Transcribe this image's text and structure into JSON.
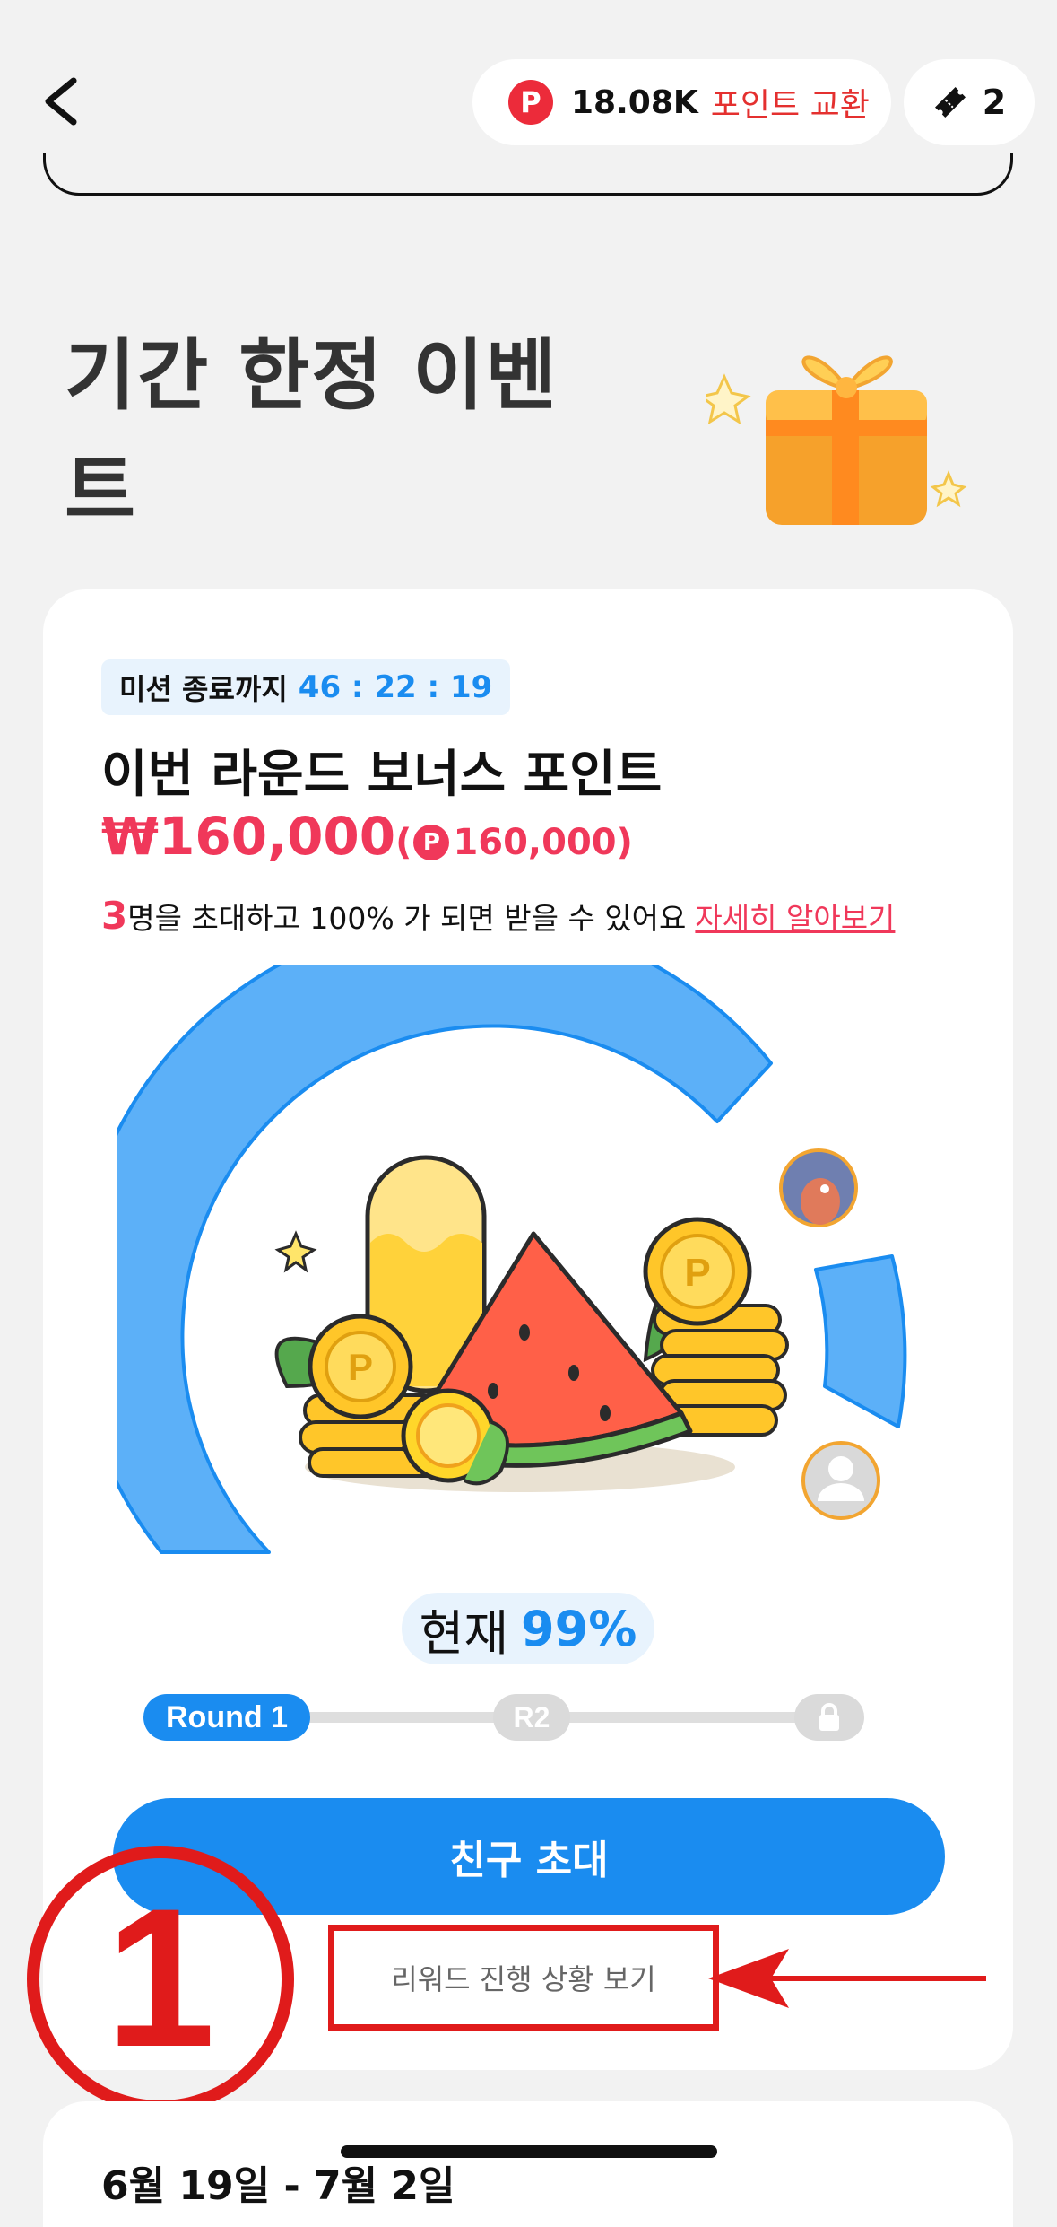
{
  "top_bar": {
    "back_icon": "chevron-left-icon",
    "points_icon": "P",
    "points_value": "18.08K",
    "points_exchange_label": "포인트 교환",
    "ticket_icon": "ticket-icon",
    "ticket_count": "2"
  },
  "event": {
    "title_line1": "기간 한정 이벤",
    "title_line2": "트",
    "gift_icon": "gift-box-icon"
  },
  "mission": {
    "timer_label": "미션 종료까지",
    "timer_value": "46 : 22 : 19",
    "round_title": "이번 라운드 보너스 포인트",
    "bonus_won": "₩160,000",
    "bonus_points_open": "(",
    "bonus_points_icon": "P",
    "bonus_points_value": "160,000)",
    "invite_count": "3",
    "invite_desc": "명을 초대하고 100% 가 되면 받을 수 있어요",
    "learn_more": "자세히 알아보기"
  },
  "progress": {
    "current_label": "현재",
    "current_value": "99%",
    "gauge_fraction": 0.99,
    "accent_color": "#1a8cf0",
    "rounds": [
      "Round 1",
      "R2"
    ],
    "lock_icon": "lock-icon"
  },
  "actions": {
    "invite_button": "친구 초대",
    "reward_progress_link": "리워드 진행 상황 보기"
  },
  "annotation": {
    "number": "1",
    "color": "#e01b1b"
  },
  "next_card": {
    "date_range": "6월 19일 - 7월 2일"
  }
}
